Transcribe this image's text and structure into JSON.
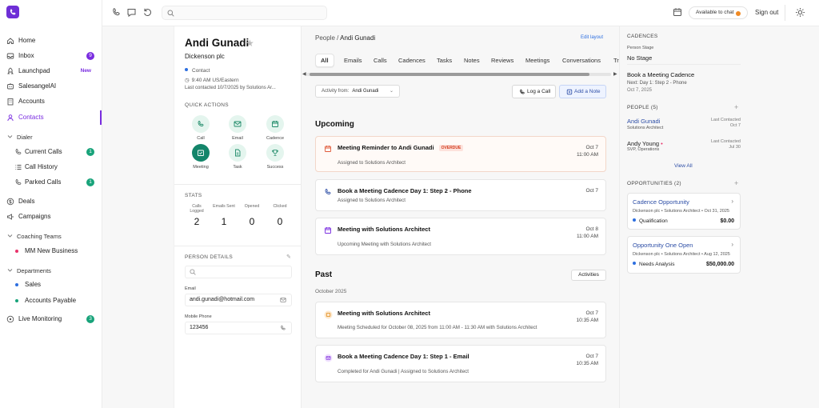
{
  "sidebar": {
    "logo_icon": "phone-logo-icon",
    "items": [
      {
        "label": "Home",
        "icon": "home-icon"
      },
      {
        "label": "Inbox",
        "icon": "inbox-icon",
        "badge": "9"
      },
      {
        "label": "Launchpad",
        "icon": "rocket-icon",
        "badge": "New"
      },
      {
        "label": "SalesangelAI",
        "icon": "ai-icon"
      },
      {
        "label": "Accounts",
        "icon": "building-icon"
      },
      {
        "label": "Contacts",
        "icon": "contacts-icon"
      }
    ],
    "dialer": {
      "label": "Dialer",
      "items": [
        {
          "label": "Current Calls",
          "badge": "1"
        },
        {
          "label": "Call History"
        },
        {
          "label": "Parked Calls",
          "badge": "1"
        }
      ]
    },
    "items2": [
      {
        "label": "Deals"
      },
      {
        "label": "Campaigns"
      }
    ],
    "coaching": {
      "label": "Coaching Teams",
      "items": [
        {
          "label": "MM New Business",
          "color": "#e8336b"
        }
      ]
    },
    "departments": {
      "label": "Departments",
      "items": [
        {
          "label": "Sales",
          "color": "#2d6fe0"
        },
        {
          "label": "Accounts Payable",
          "color": "#18a37a"
        }
      ]
    },
    "live": {
      "label": "Live Monitoring",
      "badge": "3"
    }
  },
  "topbar": {
    "search": {
      "placeholder": ""
    },
    "availability": "Available to chat",
    "availability_color": "#f08a24",
    "sign_out": "Sign out"
  },
  "person": {
    "name": "Andi Gunadi",
    "company": "Dickenson plc",
    "type": "Contact",
    "time": "9:40 AM US/Eastern",
    "last_contacted": "Last contacted 10/7/2025 by Solutions Ar...",
    "quick_actions_title": "QUICK ACTIONS",
    "quick_actions": [
      {
        "label": "Call",
        "icon": "phone-icon"
      },
      {
        "label": "Email",
        "icon": "mail-icon"
      },
      {
        "label": "Cadence",
        "icon": "calendar-icon"
      },
      {
        "label": "Meeting",
        "icon": "meeting-icon"
      },
      {
        "label": "Task",
        "icon": "task-icon"
      },
      {
        "label": "Success",
        "icon": "trophy-icon"
      }
    ],
    "stats_title": "STATS",
    "stats": [
      {
        "label": "Calls Logged",
        "value": "2"
      },
      {
        "label": "Emails Sent",
        "value": "1"
      },
      {
        "label": "Opened",
        "value": "0"
      },
      {
        "label": "Clicked",
        "value": "0"
      }
    ],
    "details_title": "PERSON DETAILS",
    "email_label": "Email",
    "email": "andi.gunadi@hotmail.com",
    "mobile_label": "Mobile Phone",
    "mobile": "123456"
  },
  "main": {
    "breadcrumb_root": "People /",
    "breadcrumb_current": "Andi Gunadi",
    "edit_layout": "Edit layout",
    "tabs": [
      "All",
      "Emails",
      "Calls",
      "Cadences",
      "Tasks",
      "Notes",
      "Reviews",
      "Meetings",
      "Conversations",
      "Tr"
    ],
    "activity_from_label": "Activity from:",
    "activity_from_value": "Andi Gunadi",
    "log_call": "Log a Call",
    "add_note": "Add a Note",
    "upcoming_title": "Upcoming",
    "upcoming": [
      {
        "title": "Meeting Reminder to Andi Gunadi",
        "tag": "OVERDUE",
        "sub": "Assigned to Solutions Architect",
        "date": "Oct 7",
        "time": "11:00 AM",
        "icon": "calendar-icon"
      },
      {
        "title": "Book a Meeting Cadence Day 1: Step 2 - Phone",
        "sub": "Assigned to Solutions Architect",
        "date": "Oct 7",
        "time": "",
        "icon": "phone-icon"
      },
      {
        "title": "Meeting with Solutions Architect",
        "sub": "Upcoming Meeting with Solutions Architect",
        "date": "Oct 8",
        "time": "11:00 AM",
        "icon": "calendar-icon"
      }
    ],
    "past_title": "Past",
    "activities_button": "Activities",
    "month": "October 2025",
    "past": [
      {
        "title": "Meeting with Solutions Architect",
        "sub": "Meeting Scheduled for October 08, 2025 from 11:00 AM - 11:30 AM with Solutions Architect",
        "date": "Oct 7",
        "time": "10:35 AM",
        "icon": "meeting-badge-icon"
      },
      {
        "title": "Book a Meeting Cadence Day 1: Step 1 - Email",
        "sub": "Completed for Andi Gunadi | Assigned to Solutions Architect",
        "date": "Oct 7",
        "time": "10:35 AM",
        "icon": "email-badge-icon"
      }
    ]
  },
  "right": {
    "cadences_title": "CADENCES",
    "person_stage_label": "Person Stage",
    "person_stage": "No Stage",
    "cadence_name": "Book a Meeting Cadence",
    "cadence_next": "Next: Day 1: Step 2 - Phone",
    "cadence_date": "Oct 7, 2025",
    "people_title": "PEOPLE (5)",
    "people": [
      {
        "name": "Andi Gunadi",
        "role": "Solutions Architect",
        "lc_label": "Last Contacted",
        "lc": "Oct 7"
      },
      {
        "name": "Andy Young",
        "role": "SVP, Operations",
        "lc_label": "Last Contacted",
        "lc": "Jul 30"
      }
    ],
    "view_all": "View All",
    "opps_title": "OPPORTUNITIES (2)",
    "opportunities": [
      {
        "name": "Cadence Opportunity",
        "sub": "Dickenson plc • Solutions Architect • Oct 31, 2025",
        "stage": "Qualification",
        "amount": "$0.00"
      },
      {
        "name": "Opportunity One Open",
        "sub": "Dickenson plc • Solutions Architect • Aug 12, 2025",
        "stage": "Needs Analysis",
        "amount": "$50,000.00"
      }
    ]
  }
}
